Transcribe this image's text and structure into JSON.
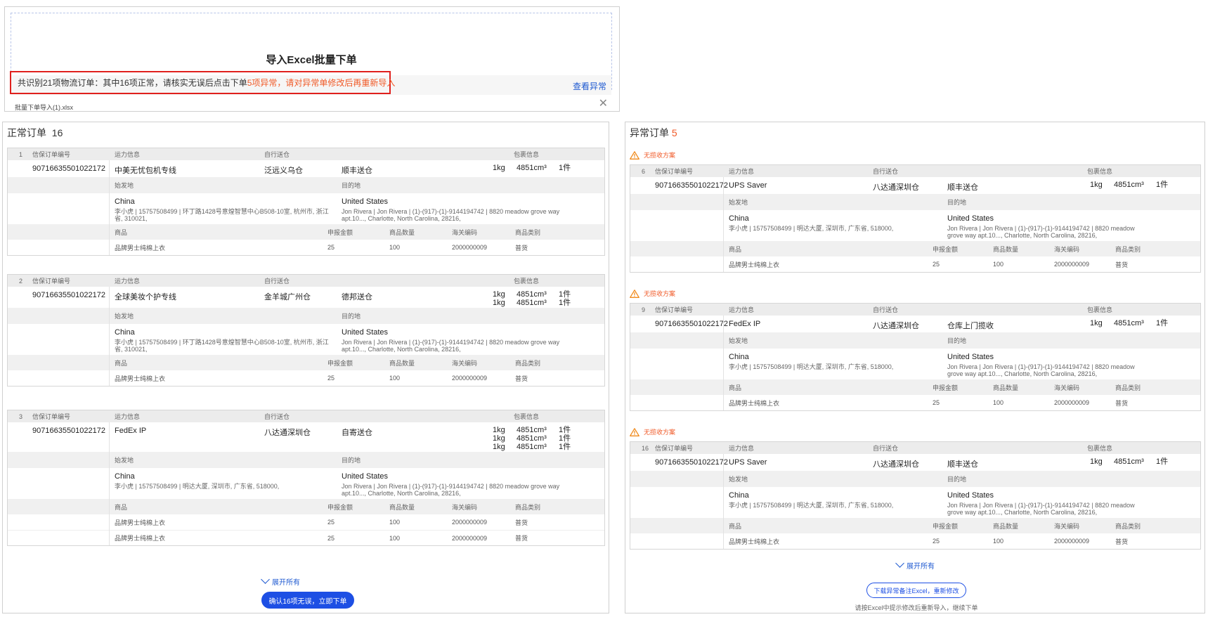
{
  "import": {
    "title": "导入Excel批量下单",
    "notice_normal": "共识别21项物流订单：其中16项正常，请核实无误后点击下单",
    "notice_error": "5项异常，请对异常单修改后再重新导入",
    "view_abnormal": "查看异常",
    "file_name": "批量下单导入(1).xlsx",
    "close": "✕"
  },
  "headers": {
    "order_no": "信保订单编号",
    "transport": "运力信息",
    "self_delivery": "自行送仓",
    "package": "包裹信息",
    "origin": "始发地",
    "destination": "目的地",
    "goods": "商品",
    "declared": "申报金额",
    "qty": "商品数量",
    "hs": "海关编码",
    "category": "商品类别"
  },
  "normal": {
    "title": "正常订单",
    "count": "16",
    "orders": [
      {
        "idx": "1",
        "order_no": "90716635501022172",
        "transport": "中美无忧包机专线",
        "warehouse": "泛远义乌仓",
        "delivery": "顺丰送仓",
        "packages": [
          {
            "w": "1kg",
            "v": "4851cm³",
            "n": "1件"
          }
        ],
        "origin_country": "China",
        "origin_addr": "李小虎 | 15757508499 | 环丁路1428号意煌智慧中心B508-10室, 杭州市, 浙江省, 310021,",
        "dest_country": "United States",
        "dest_addr": "Jon Rivera | Jon Rivera | (1)-(917)-(1)-9144194742 | 8820 meadow grove way apt.10..., Charlotte, North Carolina, 28216,",
        "goods": [
          {
            "name": "品牌男士纯棉上衣",
            "declared": "25",
            "qty": "100",
            "hs": "2000000009",
            "category": "普货"
          }
        ]
      },
      {
        "idx": "2",
        "order_no": "90716635501022172",
        "transport": "全球美妆个护专线",
        "warehouse": "金羊城广州仓",
        "delivery": "德邦送仓",
        "packages": [
          {
            "w": "1kg",
            "v": "4851cm³",
            "n": "1件"
          },
          {
            "w": "1kg",
            "v": "4851cm³",
            "n": "1件"
          }
        ],
        "origin_country": "China",
        "origin_addr": "李小虎 | 15757508499 | 环丁路1428号意煌智慧中心B508-10室, 杭州市, 浙江省, 310021,",
        "dest_country": "United States",
        "dest_addr": "Jon Rivera | Jon Rivera | (1)-(917)-(1)-9144194742 | 8820 meadow grove way apt.10..., Charlotte, North Carolina, 28216,",
        "goods": [
          {
            "name": "品牌男士纯棉上衣",
            "declared": "25",
            "qty": "100",
            "hs": "2000000009",
            "category": "普货"
          }
        ]
      },
      {
        "idx": "3",
        "order_no": "90716635501022172",
        "transport": "FedEx IP",
        "warehouse": "八达通深圳仓",
        "delivery": "自寄送仓",
        "packages": [
          {
            "w": "1kg",
            "v": "4851cm³",
            "n": "1件"
          },
          {
            "w": "1kg",
            "v": "4851cm³",
            "n": "1件"
          },
          {
            "w": "1kg",
            "v": "4851cm³",
            "n": "1件"
          }
        ],
        "origin_country": "China",
        "origin_addr": "李小虎 | 15757508499 | 明达大厦, 深圳市, 广东省, 518000,",
        "dest_country": "United States",
        "dest_addr": "Jon Rivera | Jon Rivera | (1)-(917)-(1)-9144194742 | 8820 meadow grove way apt.10..., Charlotte, North Carolina, 28216,",
        "goods": [
          {
            "name": "品牌男士纯棉上衣",
            "declared": "25",
            "qty": "100",
            "hs": "2000000009",
            "category": "普货"
          },
          {
            "name": "品牌男士纯棉上衣",
            "declared": "25",
            "qty": "100",
            "hs": "2000000009",
            "category": "普货"
          }
        ]
      }
    ],
    "expand_all": "展开所有",
    "confirm_button": "确认16项无误，立即下单"
  },
  "abnormal": {
    "title": "异常订单",
    "count": "5",
    "warning": "无揽收方案",
    "orders": [
      {
        "idx": "6",
        "order_no": "90716635501022172",
        "transport": "UPS Saver",
        "warehouse": "八达通深圳仓",
        "delivery": "顺丰送仓",
        "packages": [
          {
            "w": "1kg",
            "v": "4851cm³",
            "n": "1件"
          }
        ],
        "origin_country": "China",
        "origin_addr": "李小虎 | 15757508499 | 明达大厦, 深圳市, 广东省, 518000,",
        "dest_country": "United States",
        "dest_addr": "Jon Rivera | Jon Rivera | (1)-(917)-(1)-9144194742 | 8820 meadow grove way apt.10..., Charlotte, North Carolina, 28216,",
        "goods": [
          {
            "name": "品牌男士纯棉上衣",
            "declared": "25",
            "qty": "100",
            "hs": "2000000009",
            "category": "普货"
          }
        ]
      },
      {
        "idx": "9",
        "order_no": "90716635501022172",
        "transport": "FedEx IP",
        "warehouse": "八达通深圳仓",
        "delivery": "仓库上门揽收",
        "packages": [
          {
            "w": "1kg",
            "v": "4851cm³",
            "n": "1件"
          }
        ],
        "origin_country": "China",
        "origin_addr": "李小虎 | 15757508499 | 明达大厦, 深圳市, 广东省, 518000,",
        "dest_country": "United States",
        "dest_addr": "Jon Rivera | Jon Rivera | (1)-(917)-(1)-9144194742 | 8820 meadow grove way apt.10..., Charlotte, North Carolina, 28216,",
        "goods": [
          {
            "name": "品牌男士纯棉上衣",
            "declared": "25",
            "qty": "100",
            "hs": "2000000009",
            "category": "普货"
          }
        ]
      },
      {
        "idx": "16",
        "order_no": "90716635501022172",
        "transport": "UPS Saver",
        "warehouse": "八达通深圳仓",
        "delivery": "顺丰送仓",
        "packages": [
          {
            "w": "1kg",
            "v": "4851cm³",
            "n": "1件"
          }
        ],
        "origin_country": "China",
        "origin_addr": "李小虎 | 15757508499 | 明达大厦, 深圳市, 广东省, 518000,",
        "dest_country": "United States",
        "dest_addr": "Jon Rivera | Jon Rivera | (1)-(917)-(1)-9144194742 | 8820 meadow grove way apt.10..., Charlotte, North Carolina, 28216,",
        "goods": [
          {
            "name": "品牌男士纯棉上衣",
            "declared": "25",
            "qty": "100",
            "hs": "2000000009",
            "category": "普货"
          }
        ]
      }
    ],
    "expand_all": "展开所有",
    "download_button": "下载异常备注Excel，重新修改",
    "hint": "请按Excel中提示修改后重新导入，继续下单"
  },
  "colors": {
    "accent": "#1d4fe4",
    "error": "#f05a28",
    "highlight_border": "#e0201d"
  },
  "icons": {
    "warning": "warning-icon",
    "close": "close-icon",
    "expand": "chevron-down-icon"
  }
}
